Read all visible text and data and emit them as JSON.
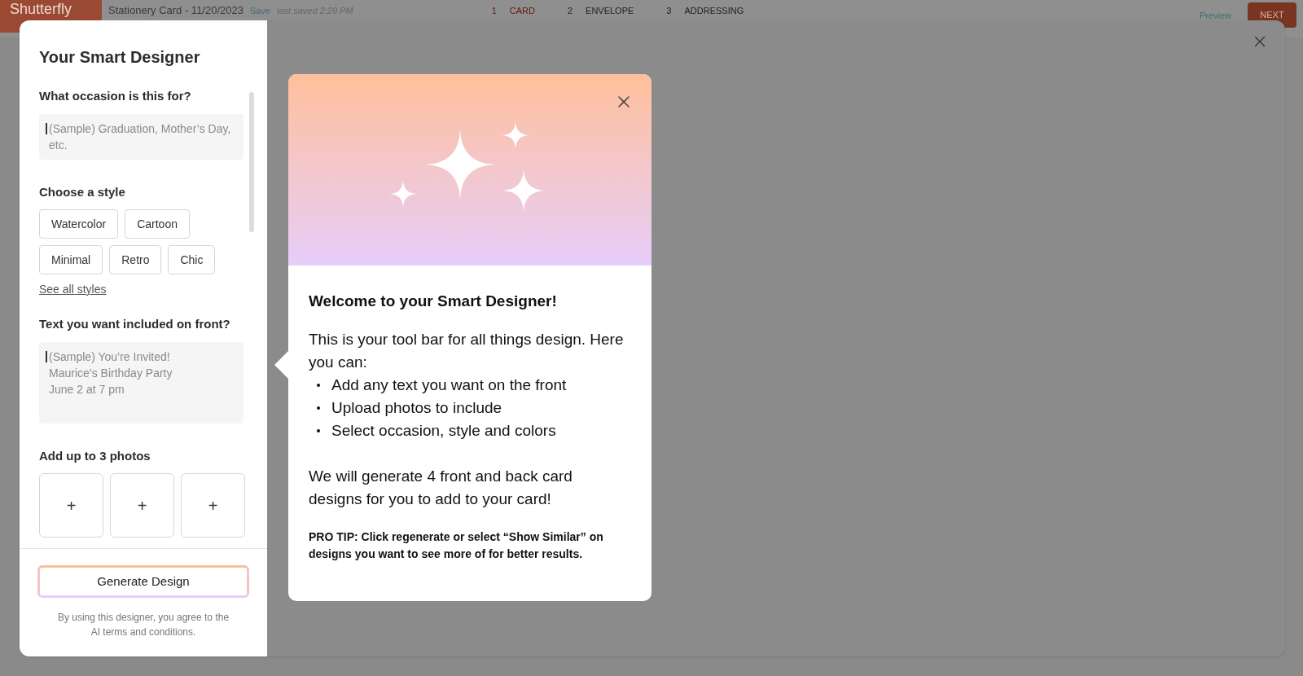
{
  "header": {
    "logo": "Shutterfly",
    "document_title": "Stationery Card - 11/20/2023",
    "save": "Save",
    "last_saved": "last saved 2:29 PM",
    "steps": [
      {
        "number": "1",
        "label": "CARD",
        "selected": true
      },
      {
        "number": "2",
        "label": "ENVELOPE",
        "selected": false
      },
      {
        "number": "3",
        "label": "ADDRESSING",
        "selected": false
      }
    ],
    "preview": "Preview",
    "next": "NEXT"
  },
  "designer": {
    "title": "Your Smart Designer",
    "occasion": {
      "label": "What occasion is this for?",
      "placeholder": "(Sample) Graduation, Mother’s Day, etc."
    },
    "style": {
      "label": "Choose a style",
      "options": [
        "Watercolor",
        "Cartoon",
        "Minimal",
        "Retro",
        "Chic"
      ],
      "see_all": "See all styles"
    },
    "front_text": {
      "label": "Text you want included on front?",
      "placeholder": "(Sample) You’re Invited!\nMaurice’s Birthday Party\nJune 2 at 7 pm"
    },
    "photos": {
      "label": "Add up to 3 photos",
      "slots": [
        "+",
        "+",
        "+"
      ]
    },
    "generate_button": "Generate Design",
    "terms": "By using this designer, you agree to the AI terms and conditions."
  },
  "welcome": {
    "title": "Welcome to your Smart Designer!",
    "intro": "This is your tool bar for all things design. Here you can:",
    "bullets": [
      "Add any text you want on the front",
      "Upload photos to include",
      "Select occasion, style and colors"
    ],
    "outro": "We will generate 4 front and back card designs for you to add to your card!",
    "pro_tip": "PRO TIP: Click regenerate or select “Show Similar” on designs you want to see more of for better results."
  }
}
